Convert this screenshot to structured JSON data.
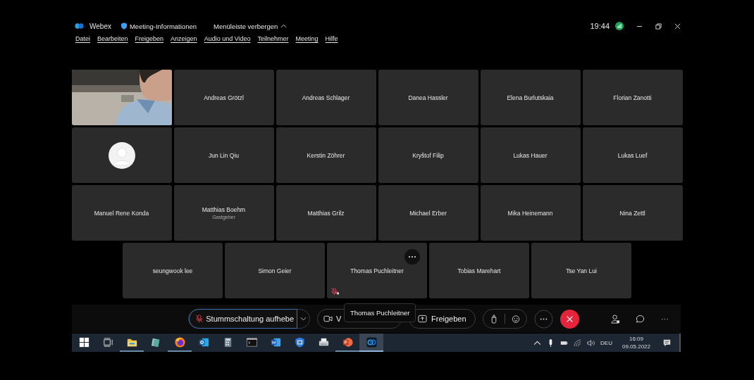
{
  "app_bar": {
    "app_name": "Webex",
    "meeting_info": "Meeting-Informationen",
    "hide_menu": "Menüleiste verbergen",
    "time": "19:44"
  },
  "menu": [
    "Datei",
    "Bearbeiten",
    "Freigeben",
    "Anzeigen",
    "Audio und Video",
    "Teilnehmer",
    "Meeting",
    "Hilfe"
  ],
  "rows": [
    [
      {
        "kind": "video",
        "muted": false,
        "hovered": false
      },
      {
        "kind": "name",
        "name": "Andreas Grötzl",
        "muted": false,
        "hovered": false
      },
      {
        "kind": "name",
        "name": "Andreas Schlager",
        "muted": false,
        "hovered": false
      },
      {
        "kind": "name",
        "name": "Danea Hassler",
        "muted": false,
        "hovered": false
      },
      {
        "kind": "name",
        "name": "Elena Burlutskaia",
        "muted": false,
        "hovered": false
      },
      {
        "kind": "name",
        "name": "Florian Zanotti",
        "muted": false,
        "hovered": false
      }
    ],
    [
      {
        "kind": "avatar",
        "muted": false,
        "hovered": false
      },
      {
        "kind": "name",
        "name": "Jun Lin Qiu",
        "muted": false,
        "hovered": false
      },
      {
        "kind": "name",
        "name": "Kerstin Zöhrer",
        "muted": false,
        "hovered": false
      },
      {
        "kind": "name",
        "name": "Kryštof Filip",
        "muted": false,
        "hovered": false
      },
      {
        "kind": "name",
        "name": "Lukas Hauer",
        "muted": false,
        "hovered": false
      },
      {
        "kind": "name",
        "name": "Lukas Luef",
        "muted": false,
        "hovered": false
      }
    ],
    [
      {
        "kind": "name",
        "name": "Manuel Rene Konda",
        "muted": false,
        "hovered": false
      },
      {
        "kind": "name",
        "name": "Matthias Boehm",
        "role": "Gastgeber",
        "muted": false,
        "hovered": false
      },
      {
        "kind": "name",
        "name": "Matthias Grilz",
        "muted": false,
        "hovered": false
      },
      {
        "kind": "name",
        "name": "Michael Erber",
        "muted": false,
        "hovered": false
      },
      {
        "kind": "name",
        "name": "Mika Heinemann",
        "muted": false,
        "hovered": false
      },
      {
        "kind": "name",
        "name": "Nina Zettl",
        "muted": false,
        "hovered": false
      }
    ],
    [
      {
        "kind": "name",
        "name": "seungwook lee",
        "muted": false,
        "hovered": false
      },
      {
        "kind": "name",
        "name": "Simon Geier",
        "muted": false,
        "hovered": false
      },
      {
        "kind": "name",
        "name": "Thomas Puchleitner",
        "muted": true,
        "hovered": true
      },
      {
        "kind": "name",
        "name": "Tobias Marehart",
        "muted": false,
        "hovered": false
      },
      {
        "kind": "name",
        "name": "Tse Yan Lui",
        "muted": false,
        "hovered": false
      }
    ]
  ],
  "controls": {
    "mute_label": "Stummschaltung aufhebe",
    "video_label": "V",
    "share_label": "Freigeben",
    "tooltip": "Thomas Puchleitner"
  },
  "taskbar": {
    "apps": [
      {
        "kind": "windows",
        "running": false,
        "active": false
      },
      {
        "kind": "taskview",
        "running": false,
        "active": false
      },
      {
        "kind": "folder",
        "running": true,
        "active": false
      },
      {
        "kind": "notes",
        "running": false,
        "active": false
      },
      {
        "kind": "firefox",
        "running": true,
        "active": false
      },
      {
        "kind": "outlook",
        "running": false,
        "active": false
      },
      {
        "kind": "calculator",
        "running": false,
        "active": false
      },
      {
        "kind": "terminal",
        "running": false,
        "active": false
      },
      {
        "kind": "word",
        "running": false,
        "active": false
      },
      {
        "kind": "shield",
        "running": false,
        "active": false
      },
      {
        "kind": "scanner",
        "running": false,
        "active": false
      },
      {
        "kind": "powerpoint",
        "running": true,
        "active": false
      },
      {
        "kind": "webex",
        "running": true,
        "active": true
      }
    ],
    "language": "DEU",
    "clock": "16:09",
    "date": "09.05.2022"
  }
}
